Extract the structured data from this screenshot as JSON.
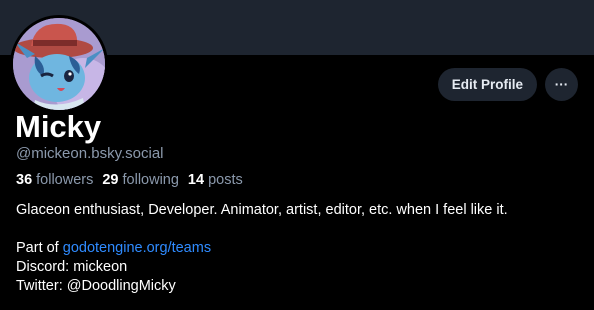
{
  "profile": {
    "display_name": "Micky",
    "handle": "@mickeon.bsky.social",
    "stats": {
      "followers_count": "36",
      "followers_label": "followers",
      "following_count": "29",
      "following_label": "following",
      "posts_count": "14",
      "posts_label": "posts"
    },
    "bio": {
      "line1": "Glaceon enthusiast, Developer. Animator, artist, editor, etc. when I feel like it.",
      "part_of_prefix": "Part of ",
      "part_of_link": "godotengine.org/teams",
      "discord": "Discord: mickeon",
      "twitter": "Twitter: @DoodlingMicky"
    }
  },
  "actions": {
    "edit_label": "Edit Profile",
    "more_label": "···"
  },
  "colors": {
    "background": "#000000",
    "banner": "#1e2530",
    "button_bg": "#1e2530",
    "muted_text": "#8b99ac",
    "link": "#2f8bff"
  },
  "icons": {
    "avatar": "glaceon-avatar-image",
    "more": "ellipsis-icon"
  }
}
